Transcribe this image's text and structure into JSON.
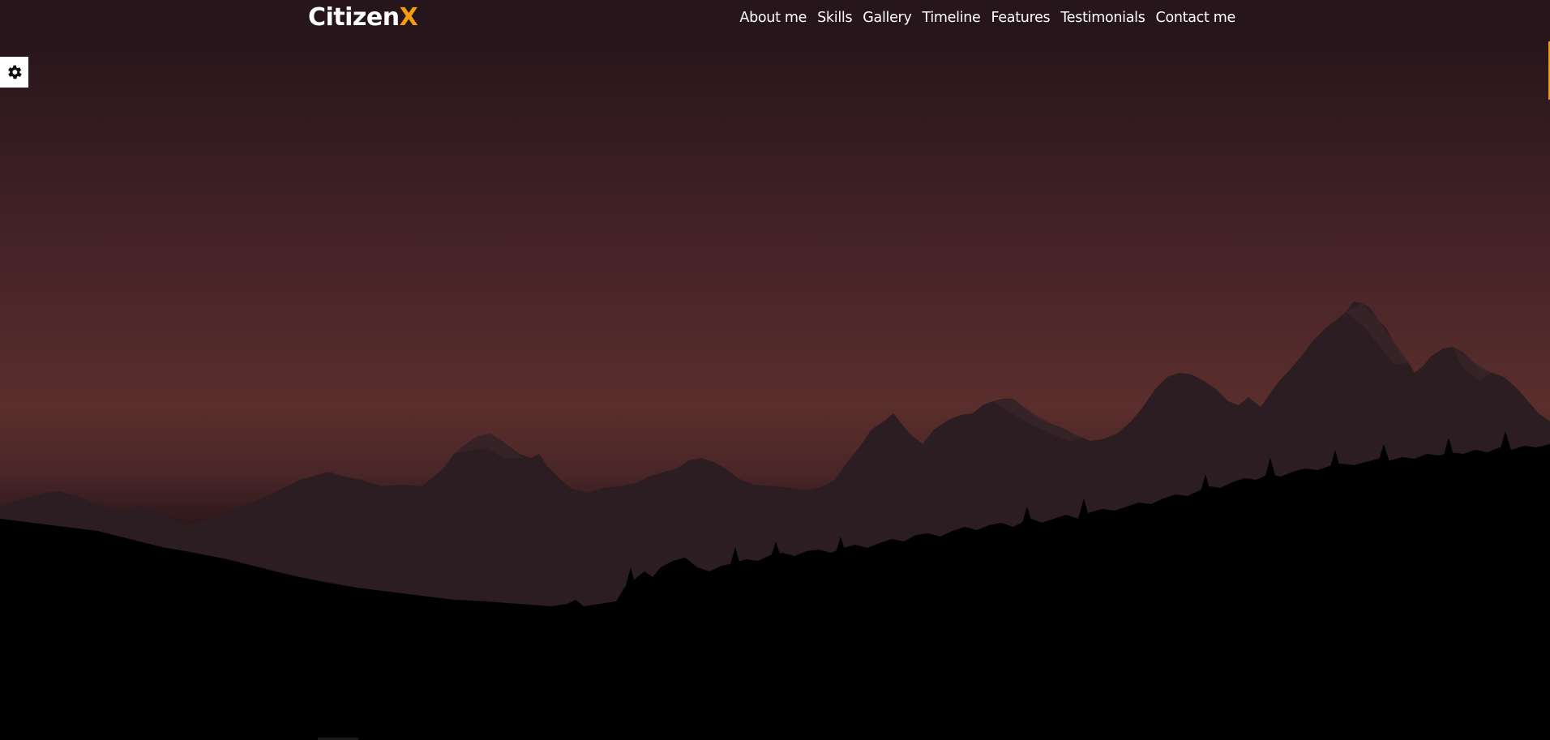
{
  "brand": {
    "name_main": "Citizen",
    "name_accent": "X",
    "accent_color": "#f39c12"
  },
  "nav": {
    "items": [
      {
        "label": "About me"
      },
      {
        "label": "Skills"
      },
      {
        "label": "Gallery"
      },
      {
        "label": "Timeline"
      },
      {
        "label": "Features"
      },
      {
        "label": "Testimonials"
      },
      {
        "label": "Contact me"
      }
    ]
  },
  "settings": {
    "icon": "gear-icon"
  },
  "colors": {
    "sky_top": "#1f1218",
    "sky_glow": "#5a2e2c",
    "mountains": "#2a1c20",
    "forest": "#000000",
    "navbar": "#28161c"
  }
}
